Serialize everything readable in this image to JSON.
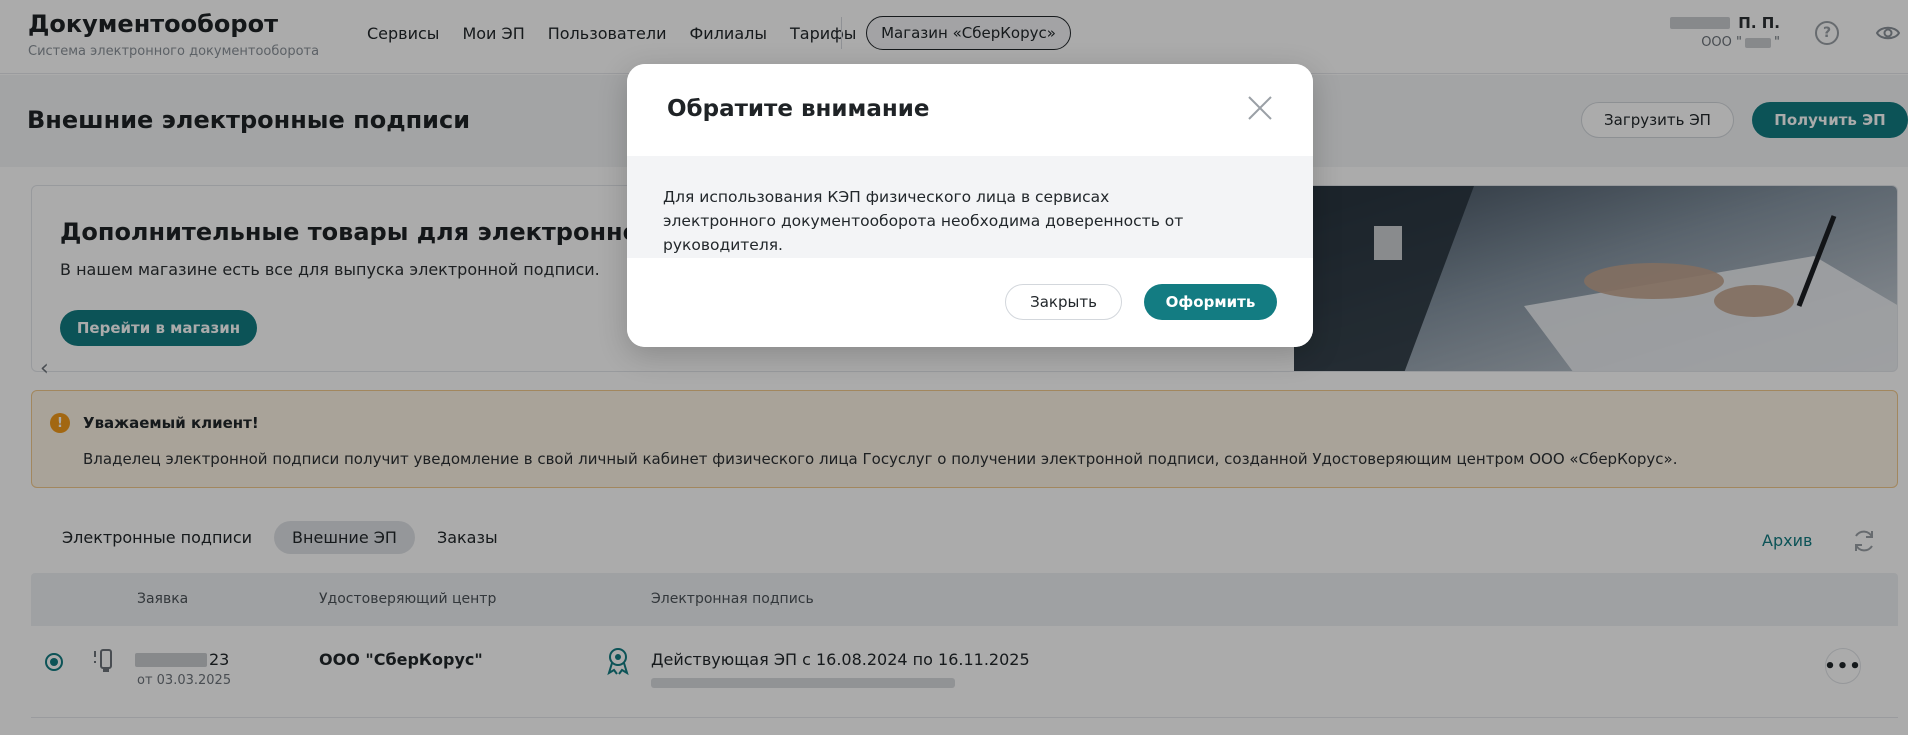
{
  "header": {
    "brand_title": "Документооборот",
    "brand_subtitle": "Система электронного документооборота",
    "nav": [
      "Сервисы",
      "Мои ЭП",
      "Пользователи",
      "Филиалы",
      "Тарифы"
    ],
    "store_button": "Магазин «СберКорус»",
    "user_name": "П. П.",
    "user_org_prefix": "ООО \"",
    "user_org_suffix": "\"",
    "help_icon": "?"
  },
  "page": {
    "title": "Внешние электронные подписи",
    "upload_button": "Загрузить ЭП",
    "get_button": "Получить ЭП"
  },
  "promo": {
    "title": "Дополнительные товары для электронной подписи",
    "text": "В нашем магазине есть все для выпуска электронной подписи.",
    "button": "Перейти в магазин",
    "prev_arrow": "‹"
  },
  "notice": {
    "icon": "!",
    "title": "Уважаемый клиент!",
    "text": "Владелец электронной подписи получит уведомление в свой личный кабинет физического лица Госуслуг о получении электронной подписи, созданной Удостоверяющим центром ООО «СберКорус»."
  },
  "tabs": {
    "items": [
      "Электронные подписи",
      "Внешние ЭП",
      "Заказы"
    ],
    "active_index": 1,
    "archive_link": "Архив"
  },
  "table": {
    "headers": [
      "Заявка",
      "Удостоверяющий центр",
      "Электронная подпись"
    ],
    "rows": [
      {
        "request_suffix": "23",
        "request_date": "от 03.03.2025",
        "ca": "ООО \"СберКорус\"",
        "signature": "Действующая ЭП с 16.08.2024 по 16.11.2025",
        "more": "•••"
      }
    ]
  },
  "modal": {
    "title": "Обратите внимание",
    "text": "Для использования КЭП физического лица в сервисах электронного документооборота необходима доверенность от руководителя.",
    "cancel_button": "Закрыть",
    "ok_button": "Оформить"
  },
  "colors": {
    "accent": "#137c82",
    "notice_bg": "#fdf3e5",
    "notice_border": "#f2c98c",
    "notice_icon": "#f29a1b"
  }
}
